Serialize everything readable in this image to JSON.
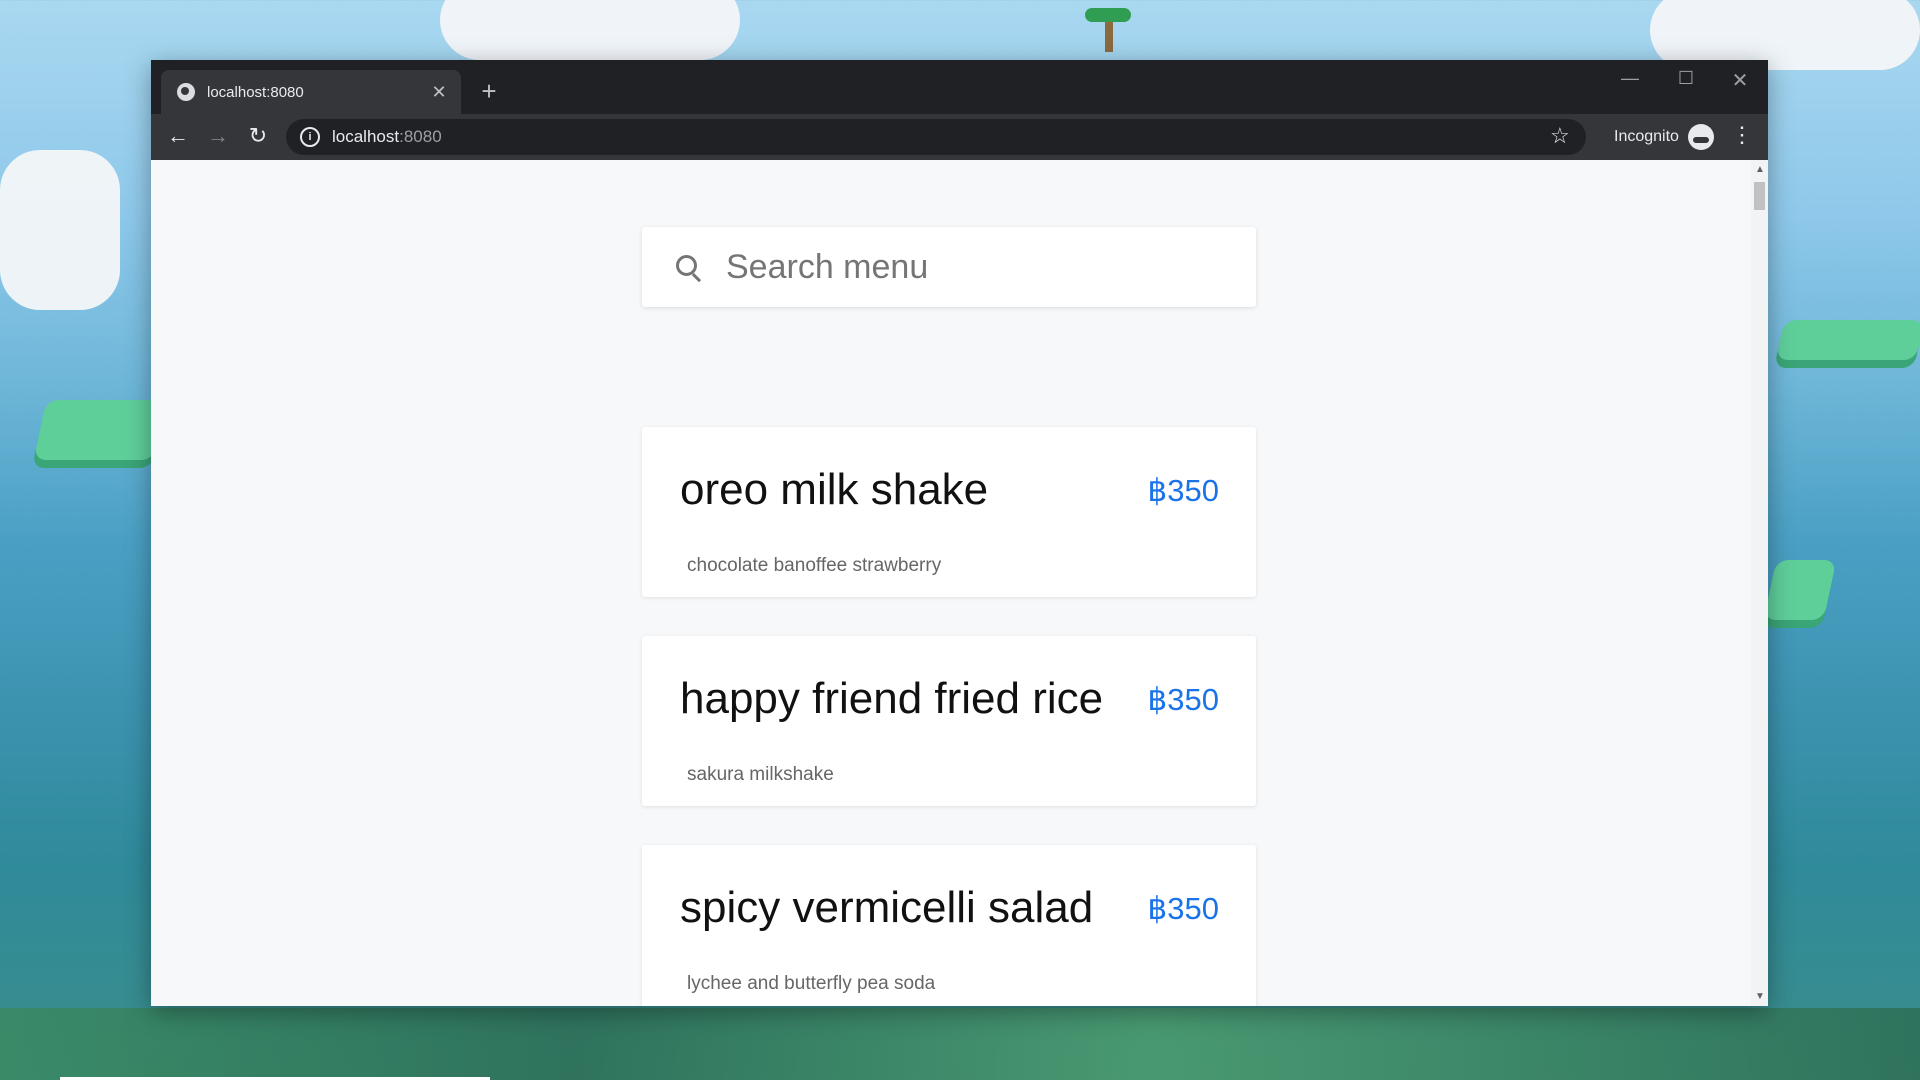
{
  "browser": {
    "tab_title": "localhost:8080",
    "tab_close": "✕",
    "new_tab": "+",
    "window_controls": {
      "minimize": "—",
      "maximize": "☐",
      "close": "✕"
    },
    "nav": {
      "back": "←",
      "forward": "→",
      "reload": "↻"
    },
    "address": {
      "host": "localhost",
      "port": ":8080",
      "info": "i"
    },
    "bookmark": "☆",
    "incognito_label": "Incognito",
    "menu": "⋮"
  },
  "page": {
    "search": {
      "placeholder": "Search menu"
    },
    "menu_items": [
      {
        "name": "oreo milk shake",
        "price": "฿350",
        "description": "chocolate banoffee strawberry"
      },
      {
        "name": "happy friend fried rice",
        "price": "฿350",
        "description": "sakura milkshake"
      },
      {
        "name": "spicy vermicelli salad",
        "price": "฿350",
        "description": "lychee and butterfly pea soda"
      }
    ]
  },
  "scrollbar": {
    "up": "▲",
    "down": "▼"
  },
  "colors": {
    "price": "#1a73e8",
    "chrome_dark": "#202124",
    "chrome_toolbar": "#35363a",
    "page_bg": "#f6f8fa"
  }
}
